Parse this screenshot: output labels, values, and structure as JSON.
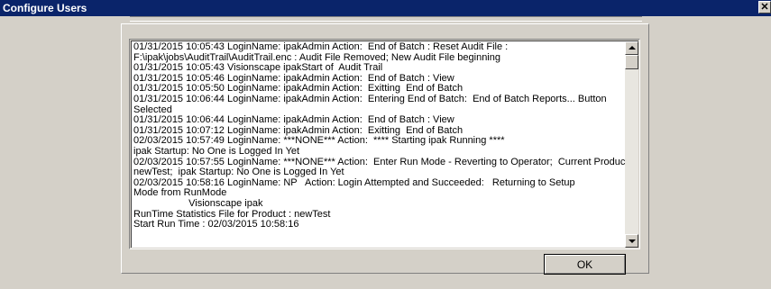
{
  "window": {
    "title": "Configure Users",
    "close_glyph": "✕"
  },
  "log": {
    "lines": [
      "01/31/2015 10:05:43 LoginName: ipakAdmin Action:  End of Batch : Reset Audit File :",
      "F:\\ipak\\jobs\\AuditTrail\\AuditTrail.enc : Audit File Removed; New Audit File beginning",
      "01/31/2015 10:05:43 Visionscape ipakStart of  Audit Trail",
      "01/31/2015 10:05:46 LoginName: ipakAdmin Action:  End of Batch : View",
      "01/31/2015 10:05:50 LoginName: ipakAdmin Action:  Exitting  End of Batch",
      "01/31/2015 10:06:44 LoginName: ipakAdmin Action:  Entering End of Batch:  End of Batch Reports... Button",
      "Selected",
      "01/31/2015 10:06:44 LoginName: ipakAdmin Action:  End of Batch : View",
      "01/31/2015 10:07:12 LoginName: ipakAdmin Action:  Exitting  End of Batch",
      "02/03/2015 10:57:49 LoginName: ***NONE*** Action:  **** Starting ipak Running ****",
      "ipak Startup: No One is Logged In Yet",
      "02/03/2015 10:57:55 LoginName: ***NONE*** Action:  Enter Run Mode - Reverting to Operator;  Current Product",
      "newTest;  ipak Startup: No One is Logged In Yet",
      "02/03/2015 10:58:16 LoginName: NP   Action: Login Attempted and Succeeded:   Returning to Setup",
      "Mode from RunMode",
      "                    Visionscape ipak",
      "RunTime Statistics File for Product : newTest",
      "Start Run Time : 02/03/2015 10:58:16"
    ]
  },
  "buttons": {
    "ok_label": "OK"
  },
  "icons": {
    "scroll_up": "arrow-up-icon",
    "scroll_down": "arrow-down-icon"
  }
}
